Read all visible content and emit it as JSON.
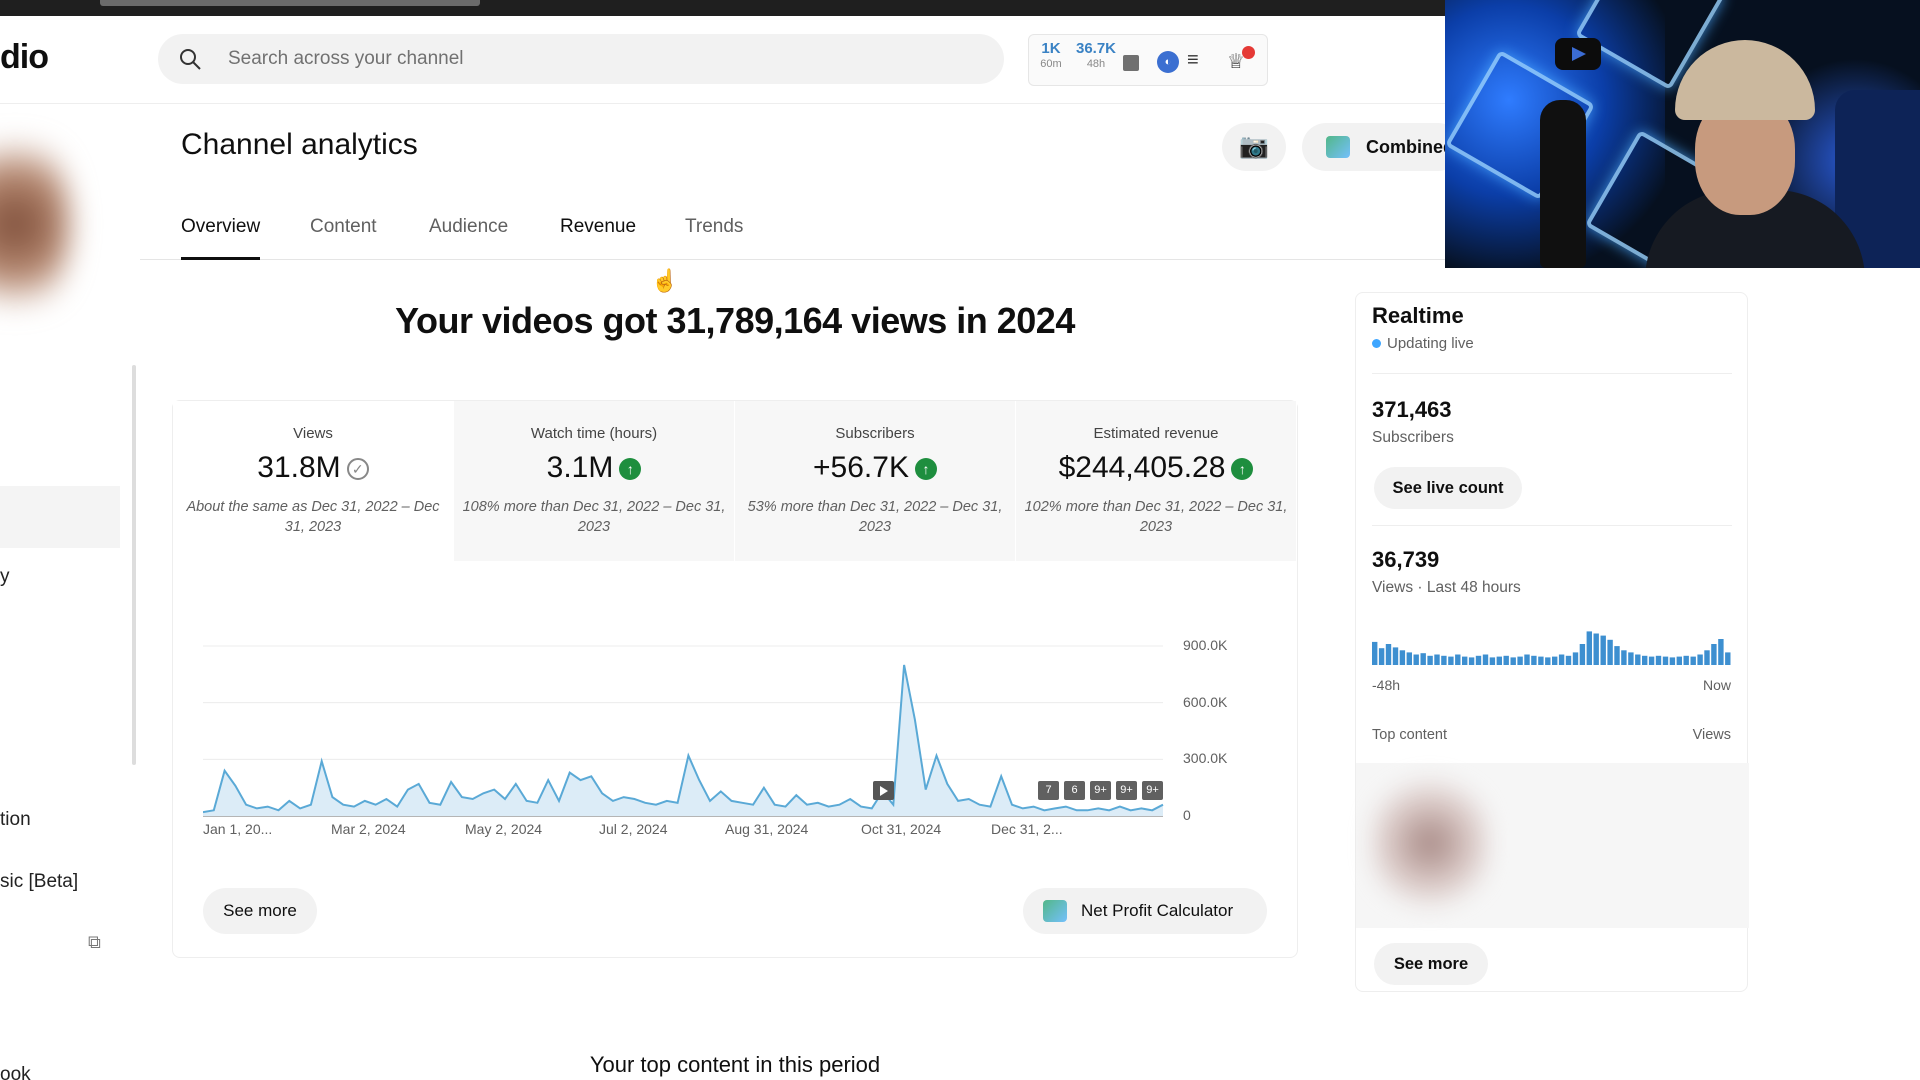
{
  "app": {
    "logo_text": "dio"
  },
  "search": {
    "placeholder": "Search across your channel"
  },
  "header_stats": {
    "stat1_value": "1K",
    "stat1_label": "60m",
    "stat2_value": "36.7K",
    "stat2_label": "48h"
  },
  "page": {
    "title": "Channel analytics",
    "combined_label": "Combined"
  },
  "tabs": [
    {
      "label": "Overview"
    },
    {
      "label": "Content"
    },
    {
      "label": "Audience"
    },
    {
      "label": "Revenue"
    },
    {
      "label": "Trends"
    }
  ],
  "headline": "Your videos got 31,789,164 views in 2024",
  "metrics": [
    {
      "label": "Views",
      "value": "31.8M",
      "compare": "About the same as Dec 31, 2022 – Dec 31, 2023"
    },
    {
      "label": "Watch time (hours)",
      "value": "3.1M",
      "compare": "108% more than Dec 31, 2022 – Dec 31, 2023"
    },
    {
      "label": "Subscribers",
      "value": "+56.7K",
      "compare": "53% more than Dec 31, 2022 – Dec 31, 2023"
    },
    {
      "label": "Estimated revenue",
      "value": "$244,405.28",
      "compare": "102% more than Dec 31, 2022 – Dec 31, 2023"
    }
  ],
  "chart_data": {
    "type": "area",
    "x_tick_labels": [
      "Jan 1, 20...",
      "Mar 2, 2024",
      "May 2, 2024",
      "Jul 2, 2024",
      "Aug 31, 2024",
      "Oct 31, 2024",
      "Dec 31, 2..."
    ],
    "y_tick_labels": [
      "900.0K",
      "600.0K",
      "300.0K",
      "0"
    ],
    "ylim": [
      0,
      900000
    ],
    "series": [
      {
        "values": [
          20000,
          30000,
          240000,
          160000,
          60000,
          40000,
          50000,
          30000,
          80000,
          40000,
          60000,
          290000,
          100000,
          60000,
          50000,
          80000,
          60000,
          90000,
          50000,
          140000,
          170000,
          70000,
          60000,
          180000,
          100000,
          90000,
          120000,
          140000,
          90000,
          170000,
          80000,
          70000,
          190000,
          80000,
          230000,
          190000,
          210000,
          120000,
          80000,
          100000,
          90000,
          70000,
          60000,
          80000,
          70000,
          320000,
          190000,
          80000,
          130000,
          80000,
          70000,
          60000,
          150000,
          60000,
          50000,
          110000,
          60000,
          70000,
          50000,
          60000,
          90000,
          50000,
          40000,
          130000,
          60000,
          800000,
          510000,
          140000,
          320000,
          170000,
          80000,
          90000,
          60000,
          50000,
          210000,
          60000,
          40000,
          50000,
          30000,
          40000,
          50000,
          30000,
          30000,
          40000,
          30000,
          50000,
          30000,
          40000,
          30000,
          60000
        ]
      }
    ],
    "markers": [
      "7",
      "6",
      "9+",
      "9+",
      "9+"
    ]
  },
  "buttons": {
    "see_more": "See more",
    "net_profit": "Net Profit Calculator"
  },
  "top_content_heading": "Your top content in this period",
  "realtime": {
    "title": "Realtime",
    "status": "Updating live",
    "subscribers_value": "371,463",
    "subscribers_label": "Subscribers",
    "see_live_count": "See live count",
    "views_value": "36,739",
    "views_label": "Views · Last 48 hours",
    "axis_start": "-48h",
    "axis_end": "Now",
    "top_content_label": "Top content",
    "views_col_label": "Views",
    "see_more": "See more",
    "bar_values": [
      0.55,
      0.4,
      0.5,
      0.42,
      0.35,
      0.3,
      0.25,
      0.28,
      0.22,
      0.25,
      0.22,
      0.2,
      0.25,
      0.2,
      0.18,
      0.22,
      0.25,
      0.18,
      0.2,
      0.22,
      0.18,
      0.2,
      0.25,
      0.22,
      0.2,
      0.18,
      0.2,
      0.25,
      0.22,
      0.3,
      0.5,
      0.8,
      0.75,
      0.7,
      0.6,
      0.45,
      0.35,
      0.3,
      0.25,
      0.22,
      0.2,
      0.22,
      0.2,
      0.18,
      0.2,
      0.22,
      0.2,
      0.25,
      0.35,
      0.5,
      0.62,
      0.3
    ]
  },
  "sidebar": {
    "item_y": "y",
    "item_tion": "tion",
    "item_beta": "sic [Beta]",
    "item_bottom": "ook"
  },
  "colors": {
    "accent_blue": "#3ea6ff",
    "chart_line": "#5aa9d6",
    "chart_fill": "#dcecf7",
    "up_green": "#1e8e3e"
  }
}
